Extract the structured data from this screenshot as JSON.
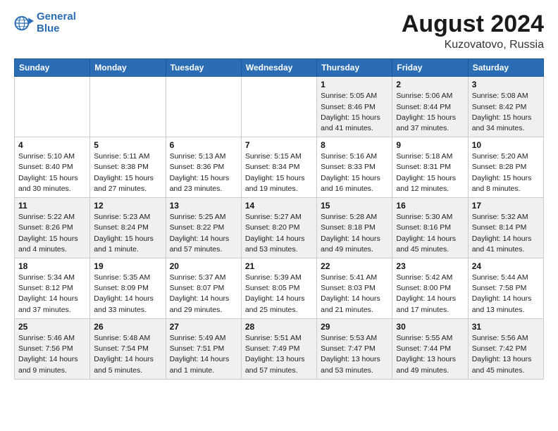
{
  "header": {
    "logo_line1": "General",
    "logo_line2": "Blue",
    "main_title": "August 2024",
    "subtitle": "Kuzovatovo, Russia"
  },
  "weekdays": [
    "Sunday",
    "Monday",
    "Tuesday",
    "Wednesday",
    "Thursday",
    "Friday",
    "Saturday"
  ],
  "weeks": [
    [
      {
        "day": "",
        "info": ""
      },
      {
        "day": "",
        "info": ""
      },
      {
        "day": "",
        "info": ""
      },
      {
        "day": "",
        "info": ""
      },
      {
        "day": "1",
        "info": "Sunrise: 5:05 AM\nSunset: 8:46 PM\nDaylight: 15 hours\nand 41 minutes."
      },
      {
        "day": "2",
        "info": "Sunrise: 5:06 AM\nSunset: 8:44 PM\nDaylight: 15 hours\nand 37 minutes."
      },
      {
        "day": "3",
        "info": "Sunrise: 5:08 AM\nSunset: 8:42 PM\nDaylight: 15 hours\nand 34 minutes."
      }
    ],
    [
      {
        "day": "4",
        "info": "Sunrise: 5:10 AM\nSunset: 8:40 PM\nDaylight: 15 hours\nand 30 minutes."
      },
      {
        "day": "5",
        "info": "Sunrise: 5:11 AM\nSunset: 8:38 PM\nDaylight: 15 hours\nand 27 minutes."
      },
      {
        "day": "6",
        "info": "Sunrise: 5:13 AM\nSunset: 8:36 PM\nDaylight: 15 hours\nand 23 minutes."
      },
      {
        "day": "7",
        "info": "Sunrise: 5:15 AM\nSunset: 8:34 PM\nDaylight: 15 hours\nand 19 minutes."
      },
      {
        "day": "8",
        "info": "Sunrise: 5:16 AM\nSunset: 8:33 PM\nDaylight: 15 hours\nand 16 minutes."
      },
      {
        "day": "9",
        "info": "Sunrise: 5:18 AM\nSunset: 8:31 PM\nDaylight: 15 hours\nand 12 minutes."
      },
      {
        "day": "10",
        "info": "Sunrise: 5:20 AM\nSunset: 8:28 PM\nDaylight: 15 hours\nand 8 minutes."
      }
    ],
    [
      {
        "day": "11",
        "info": "Sunrise: 5:22 AM\nSunset: 8:26 PM\nDaylight: 15 hours\nand 4 minutes."
      },
      {
        "day": "12",
        "info": "Sunrise: 5:23 AM\nSunset: 8:24 PM\nDaylight: 15 hours\nand 1 minute."
      },
      {
        "day": "13",
        "info": "Sunrise: 5:25 AM\nSunset: 8:22 PM\nDaylight: 14 hours\nand 57 minutes."
      },
      {
        "day": "14",
        "info": "Sunrise: 5:27 AM\nSunset: 8:20 PM\nDaylight: 14 hours\nand 53 minutes."
      },
      {
        "day": "15",
        "info": "Sunrise: 5:28 AM\nSunset: 8:18 PM\nDaylight: 14 hours\nand 49 minutes."
      },
      {
        "day": "16",
        "info": "Sunrise: 5:30 AM\nSunset: 8:16 PM\nDaylight: 14 hours\nand 45 minutes."
      },
      {
        "day": "17",
        "info": "Sunrise: 5:32 AM\nSunset: 8:14 PM\nDaylight: 14 hours\nand 41 minutes."
      }
    ],
    [
      {
        "day": "18",
        "info": "Sunrise: 5:34 AM\nSunset: 8:12 PM\nDaylight: 14 hours\nand 37 minutes."
      },
      {
        "day": "19",
        "info": "Sunrise: 5:35 AM\nSunset: 8:09 PM\nDaylight: 14 hours\nand 33 minutes."
      },
      {
        "day": "20",
        "info": "Sunrise: 5:37 AM\nSunset: 8:07 PM\nDaylight: 14 hours\nand 29 minutes."
      },
      {
        "day": "21",
        "info": "Sunrise: 5:39 AM\nSunset: 8:05 PM\nDaylight: 14 hours\nand 25 minutes."
      },
      {
        "day": "22",
        "info": "Sunrise: 5:41 AM\nSunset: 8:03 PM\nDaylight: 14 hours\nand 21 minutes."
      },
      {
        "day": "23",
        "info": "Sunrise: 5:42 AM\nSunset: 8:00 PM\nDaylight: 14 hours\nand 17 minutes."
      },
      {
        "day": "24",
        "info": "Sunrise: 5:44 AM\nSunset: 7:58 PM\nDaylight: 14 hours\nand 13 minutes."
      }
    ],
    [
      {
        "day": "25",
        "info": "Sunrise: 5:46 AM\nSunset: 7:56 PM\nDaylight: 14 hours\nand 9 minutes."
      },
      {
        "day": "26",
        "info": "Sunrise: 5:48 AM\nSunset: 7:54 PM\nDaylight: 14 hours\nand 5 minutes."
      },
      {
        "day": "27",
        "info": "Sunrise: 5:49 AM\nSunset: 7:51 PM\nDaylight: 14 hours\nand 1 minute."
      },
      {
        "day": "28",
        "info": "Sunrise: 5:51 AM\nSunset: 7:49 PM\nDaylight: 13 hours\nand 57 minutes."
      },
      {
        "day": "29",
        "info": "Sunrise: 5:53 AM\nSunset: 7:47 PM\nDaylight: 13 hours\nand 53 minutes."
      },
      {
        "day": "30",
        "info": "Sunrise: 5:55 AM\nSunset: 7:44 PM\nDaylight: 13 hours\nand 49 minutes."
      },
      {
        "day": "31",
        "info": "Sunrise: 5:56 AM\nSunset: 7:42 PM\nDaylight: 13 hours\nand 45 minutes."
      }
    ]
  ]
}
